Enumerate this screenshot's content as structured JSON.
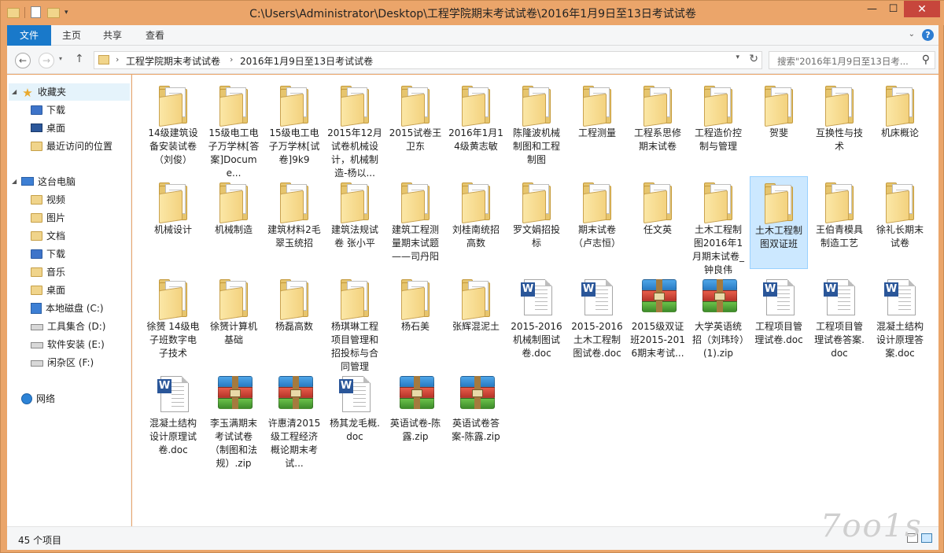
{
  "window": {
    "title": "C:\\Users\\Administrator\\Desktop\\工程学院期末考试试卷\\2016年1月9日至13日考试试卷",
    "minimize_glyph": "—",
    "maximize_glyph": "☐",
    "close_glyph": "✕"
  },
  "ribbon": {
    "tabs": [
      "文件",
      "主页",
      "共享",
      "查看"
    ],
    "help_glyph": "?",
    "expand_glyph": "⌄"
  },
  "address_bar": {
    "crumbs": [
      "工程学院期末考试试卷",
      "2016年1月9日至13日考试试卷"
    ],
    "search_placeholder": "搜索\"2016年1月9日至13日考...",
    "back_glyph": "←",
    "forward_glyph": "→",
    "up_glyph": "↑",
    "refresh_glyph": "↻",
    "search_glyph": "⚲"
  },
  "nav_pane": {
    "favorites": {
      "label": "收藏夹",
      "items": [
        "下载",
        "桌面",
        "最近访问的位置"
      ]
    },
    "this_pc": {
      "label": "这台电脑",
      "items": [
        "视频",
        "图片",
        "文档",
        "下载",
        "音乐",
        "桌面",
        "本地磁盘 (C:)",
        "工具集合 (D:)",
        "软件安装 (E:)",
        "闲杂区 (F:)"
      ]
    },
    "network": {
      "label": "网络"
    }
  },
  "files": [
    {
      "name": "14级建筑设备安装试卷（刘俊）",
      "type": "folder"
    },
    {
      "name": "15级电工电子万学林[答案]Docume...",
      "type": "folder"
    },
    {
      "name": "15级电工电子万学林[试卷]9k9",
      "type": "folder"
    },
    {
      "name": "2015年12月试卷机械设计，机械制造-杨以...",
      "type": "folder"
    },
    {
      "name": "2015试卷王卫东",
      "type": "folder"
    },
    {
      "name": "2016年1月14级黄志敏",
      "type": "folder"
    },
    {
      "name": "陈隆波机械制图和工程制图",
      "type": "folder"
    },
    {
      "name": "工程测量",
      "type": "folder"
    },
    {
      "name": "工程系思修期末试卷",
      "type": "folder"
    },
    {
      "name": "工程造价控制与管理",
      "type": "folder"
    },
    {
      "name": "贺斐",
      "type": "folder"
    },
    {
      "name": "互换性与技术",
      "type": "folder"
    },
    {
      "name": "机床概论",
      "type": "folder"
    },
    {
      "name": "机械设计",
      "type": "folder"
    },
    {
      "name": "机械制造",
      "type": "folder"
    },
    {
      "name": "建筑材料2毛翠玉统招",
      "type": "folder"
    },
    {
      "name": "建筑法规试卷  张小平",
      "type": "folder"
    },
    {
      "name": "建筑工程测量期末试题——司丹阳",
      "type": "folder"
    },
    {
      "name": "刘桂南统招高数",
      "type": "folder"
    },
    {
      "name": "罗文娟招投标",
      "type": "folder"
    },
    {
      "name": "期末试卷（卢志恒）",
      "type": "folder"
    },
    {
      "name": "任文英",
      "type": "folder"
    },
    {
      "name": "土木工程制图2016年1月期末试卷_钟良伟",
      "type": "folder"
    },
    {
      "name": "土木工程制图双证班",
      "type": "folder",
      "selected": true
    },
    {
      "name": "王伯青模具制造工艺",
      "type": "folder"
    },
    {
      "name": "徐礼长期末试卷",
      "type": "folder"
    },
    {
      "name": "徐赟 14级电子班数字电子技术",
      "type": "folder"
    },
    {
      "name": "徐赟计算机基础",
      "type": "folder"
    },
    {
      "name": "杨磊高数",
      "type": "folder"
    },
    {
      "name": "杨琪琳工程项目管理和招投标与合同管理",
      "type": "folder"
    },
    {
      "name": "杨石美",
      "type": "folder"
    },
    {
      "name": "张辉混泥土",
      "type": "folder"
    },
    {
      "name": "2015-2016机械制图试卷.doc",
      "type": "doc"
    },
    {
      "name": "2015-2016土木工程制图试卷.doc",
      "type": "doc"
    },
    {
      "name": "2015级双证班2015-2016期末考试...",
      "type": "zip"
    },
    {
      "name": "大学英语统招（刘玮玲）(1).zip",
      "type": "zip"
    },
    {
      "name": "工程项目管理试卷.doc",
      "type": "doc"
    },
    {
      "name": "工程项目管理试卷答案.doc",
      "type": "doc"
    },
    {
      "name": "混凝土结构设计原理答案.doc",
      "type": "doc"
    },
    {
      "name": "混凝土结构设计原理试卷.doc",
      "type": "doc"
    },
    {
      "name": "李玉满期末考试试卷（制图和法规）.zip",
      "type": "zip"
    },
    {
      "name": "许惠清2015级工程经济概论期末考试...",
      "type": "zip"
    },
    {
      "name": "杨其龙毛概.doc",
      "type": "doc"
    },
    {
      "name": "英语试卷-陈露.zip",
      "type": "zip"
    },
    {
      "name": "英语试卷答案-陈露.zip",
      "type": "zip"
    }
  ],
  "status": {
    "item_count": "45 个项目"
  },
  "colors": {
    "title_bar": "#eba56a",
    "file_tab": "#1979ca",
    "selection": "#cce8ff"
  }
}
